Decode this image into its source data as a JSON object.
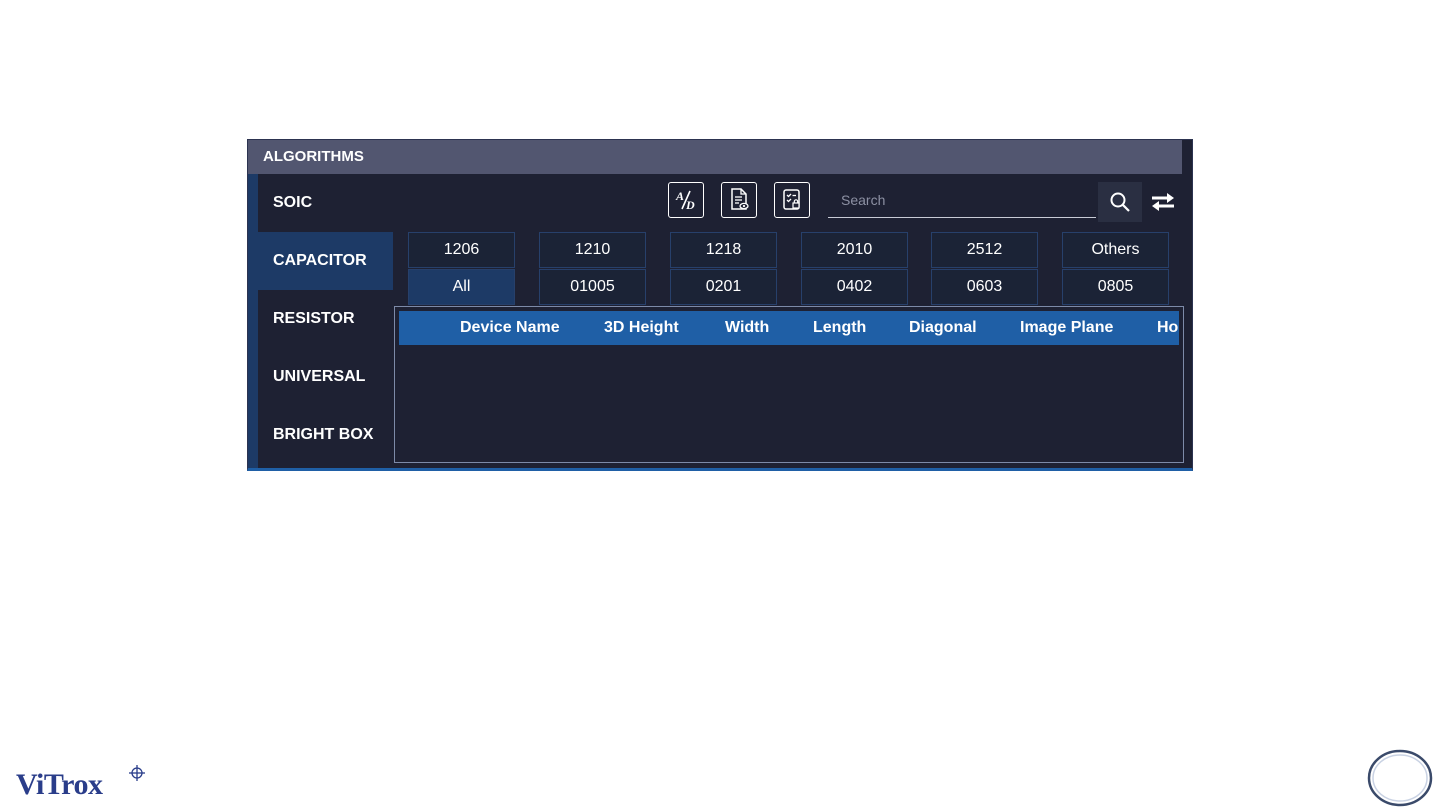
{
  "panel": {
    "title": "ALGORITHMS"
  },
  "sidebar": {
    "items": [
      {
        "label": "SOIC",
        "active": false
      },
      {
        "label": "CAPACITOR",
        "active": true
      },
      {
        "label": "RESISTOR",
        "active": false
      },
      {
        "label": "UNIVERSAL",
        "active": false
      },
      {
        "label": "BRIGHT BOX",
        "active": false
      }
    ]
  },
  "toolbar": {
    "icon_ad": "ad-toggle-icon",
    "icon_view": "document-view-icon",
    "icon_lock": "checklist-lock-icon",
    "search_placeholder": "Search",
    "search_icon": "search-icon",
    "swap_icon": "swap-arrows-icon"
  },
  "sizes": {
    "row1": [
      "1206",
      "1210",
      "1218",
      "2010",
      "2512",
      "Others"
    ],
    "row2": [
      "All",
      "01005",
      "0201",
      "0402",
      "0603",
      "0805"
    ],
    "selected": "All"
  },
  "table": {
    "columns": [
      "Device Name",
      "3D Height",
      "Width",
      "Length",
      "Diagonal",
      "Image Plane",
      "Ho"
    ]
  },
  "footer": {
    "logo_text": "ViTrox"
  },
  "colors": {
    "panel_bg": "#1e2133",
    "header_bg": "#525670",
    "accent": "#1f5fa6",
    "active_nav": "#1d3a66"
  }
}
